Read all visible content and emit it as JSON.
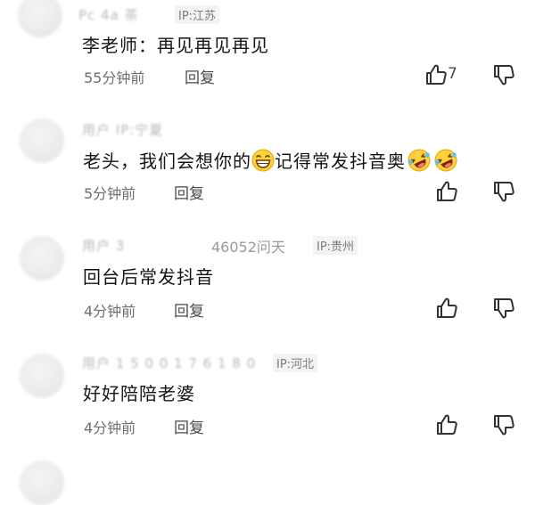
{
  "comments": [
    {
      "username": "Pc 4a 茶",
      "ip": "IP:江苏",
      "text": "李老师：再见再见再见",
      "time": "55分钟前",
      "reply": "回复",
      "likes": "7"
    },
    {
      "username": "用户 IP:宁夏",
      "ip": "",
      "text_before": "老头，我们会想你的",
      "text_after": "记得常发抖音奥",
      "time": "5分钟前",
      "reply": "回复"
    },
    {
      "username_blur": "用户 3",
      "username_clear": "46052问天",
      "ip": "IP:贵州",
      "text": "回台后常发抖音",
      "time": "4分钟前",
      "reply": "回复"
    },
    {
      "username": "用户 1 5 0 0 1 7 6 1 8 0",
      "ip": "IP:河北",
      "text": "好好陪陪老婆",
      "time": "4分钟前",
      "reply": "回复"
    }
  ],
  "icons": {
    "like": "thumbs-up-icon",
    "dislike": "thumbs-down-icon",
    "grin": "grinning-emoji-icon",
    "laugh": "rolling-laughing-emoji-icon"
  }
}
